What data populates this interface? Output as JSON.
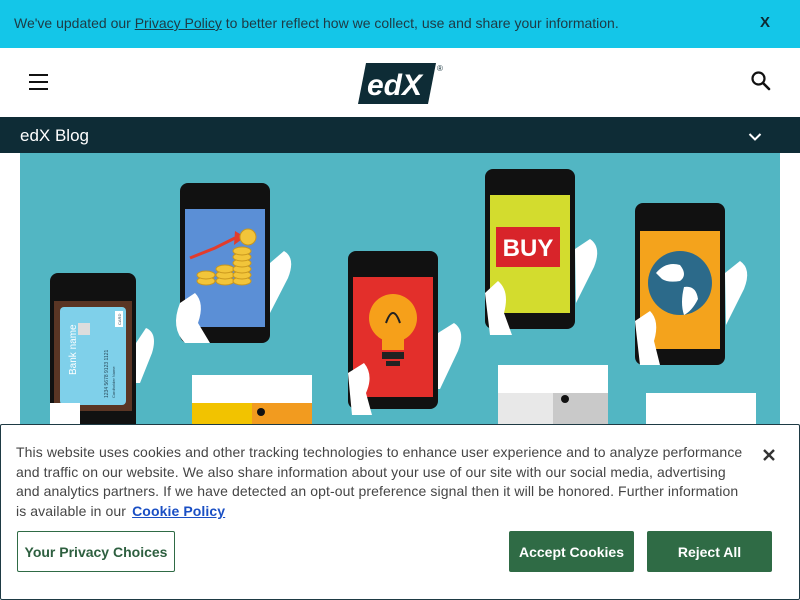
{
  "privacy_notice": {
    "text_before": "We've updated our ",
    "link_text": "Privacy Policy",
    "text_after": " to better reflect how we collect, use and share your information.",
    "close_label": "X"
  },
  "header": {
    "logo_text": "edX",
    "logo_mark": "®"
  },
  "blog_nav": {
    "title": "edX Blog"
  },
  "hero": {
    "card_text": "Bank name",
    "card_number": "1234 5678 9123 1121",
    "card_holder": "Cardholder Name",
    "card_chip": "CARD",
    "buy_sign": "BUY"
  },
  "cookie_banner": {
    "text": "This website uses cookies and other tracking technologies to enhance user experience and to analyze performance and traffic on our website. We also share information about your use of our site with our social media, advertising and analytics partners. If we have detected an opt-out preference signal then it will be honored. Further information is available in our",
    "link_text": "Cookie Policy",
    "choices_label": "Your Privacy Choices",
    "accept_label": "Accept Cookies",
    "reject_label": "Reject All"
  },
  "colors": {
    "privacy_bar": "#14c6e8",
    "dark_band": "#0e2c36",
    "hero_bg": "#52b6c3",
    "button_green": "#2f6b45",
    "link_blue": "#1a4fc4"
  }
}
